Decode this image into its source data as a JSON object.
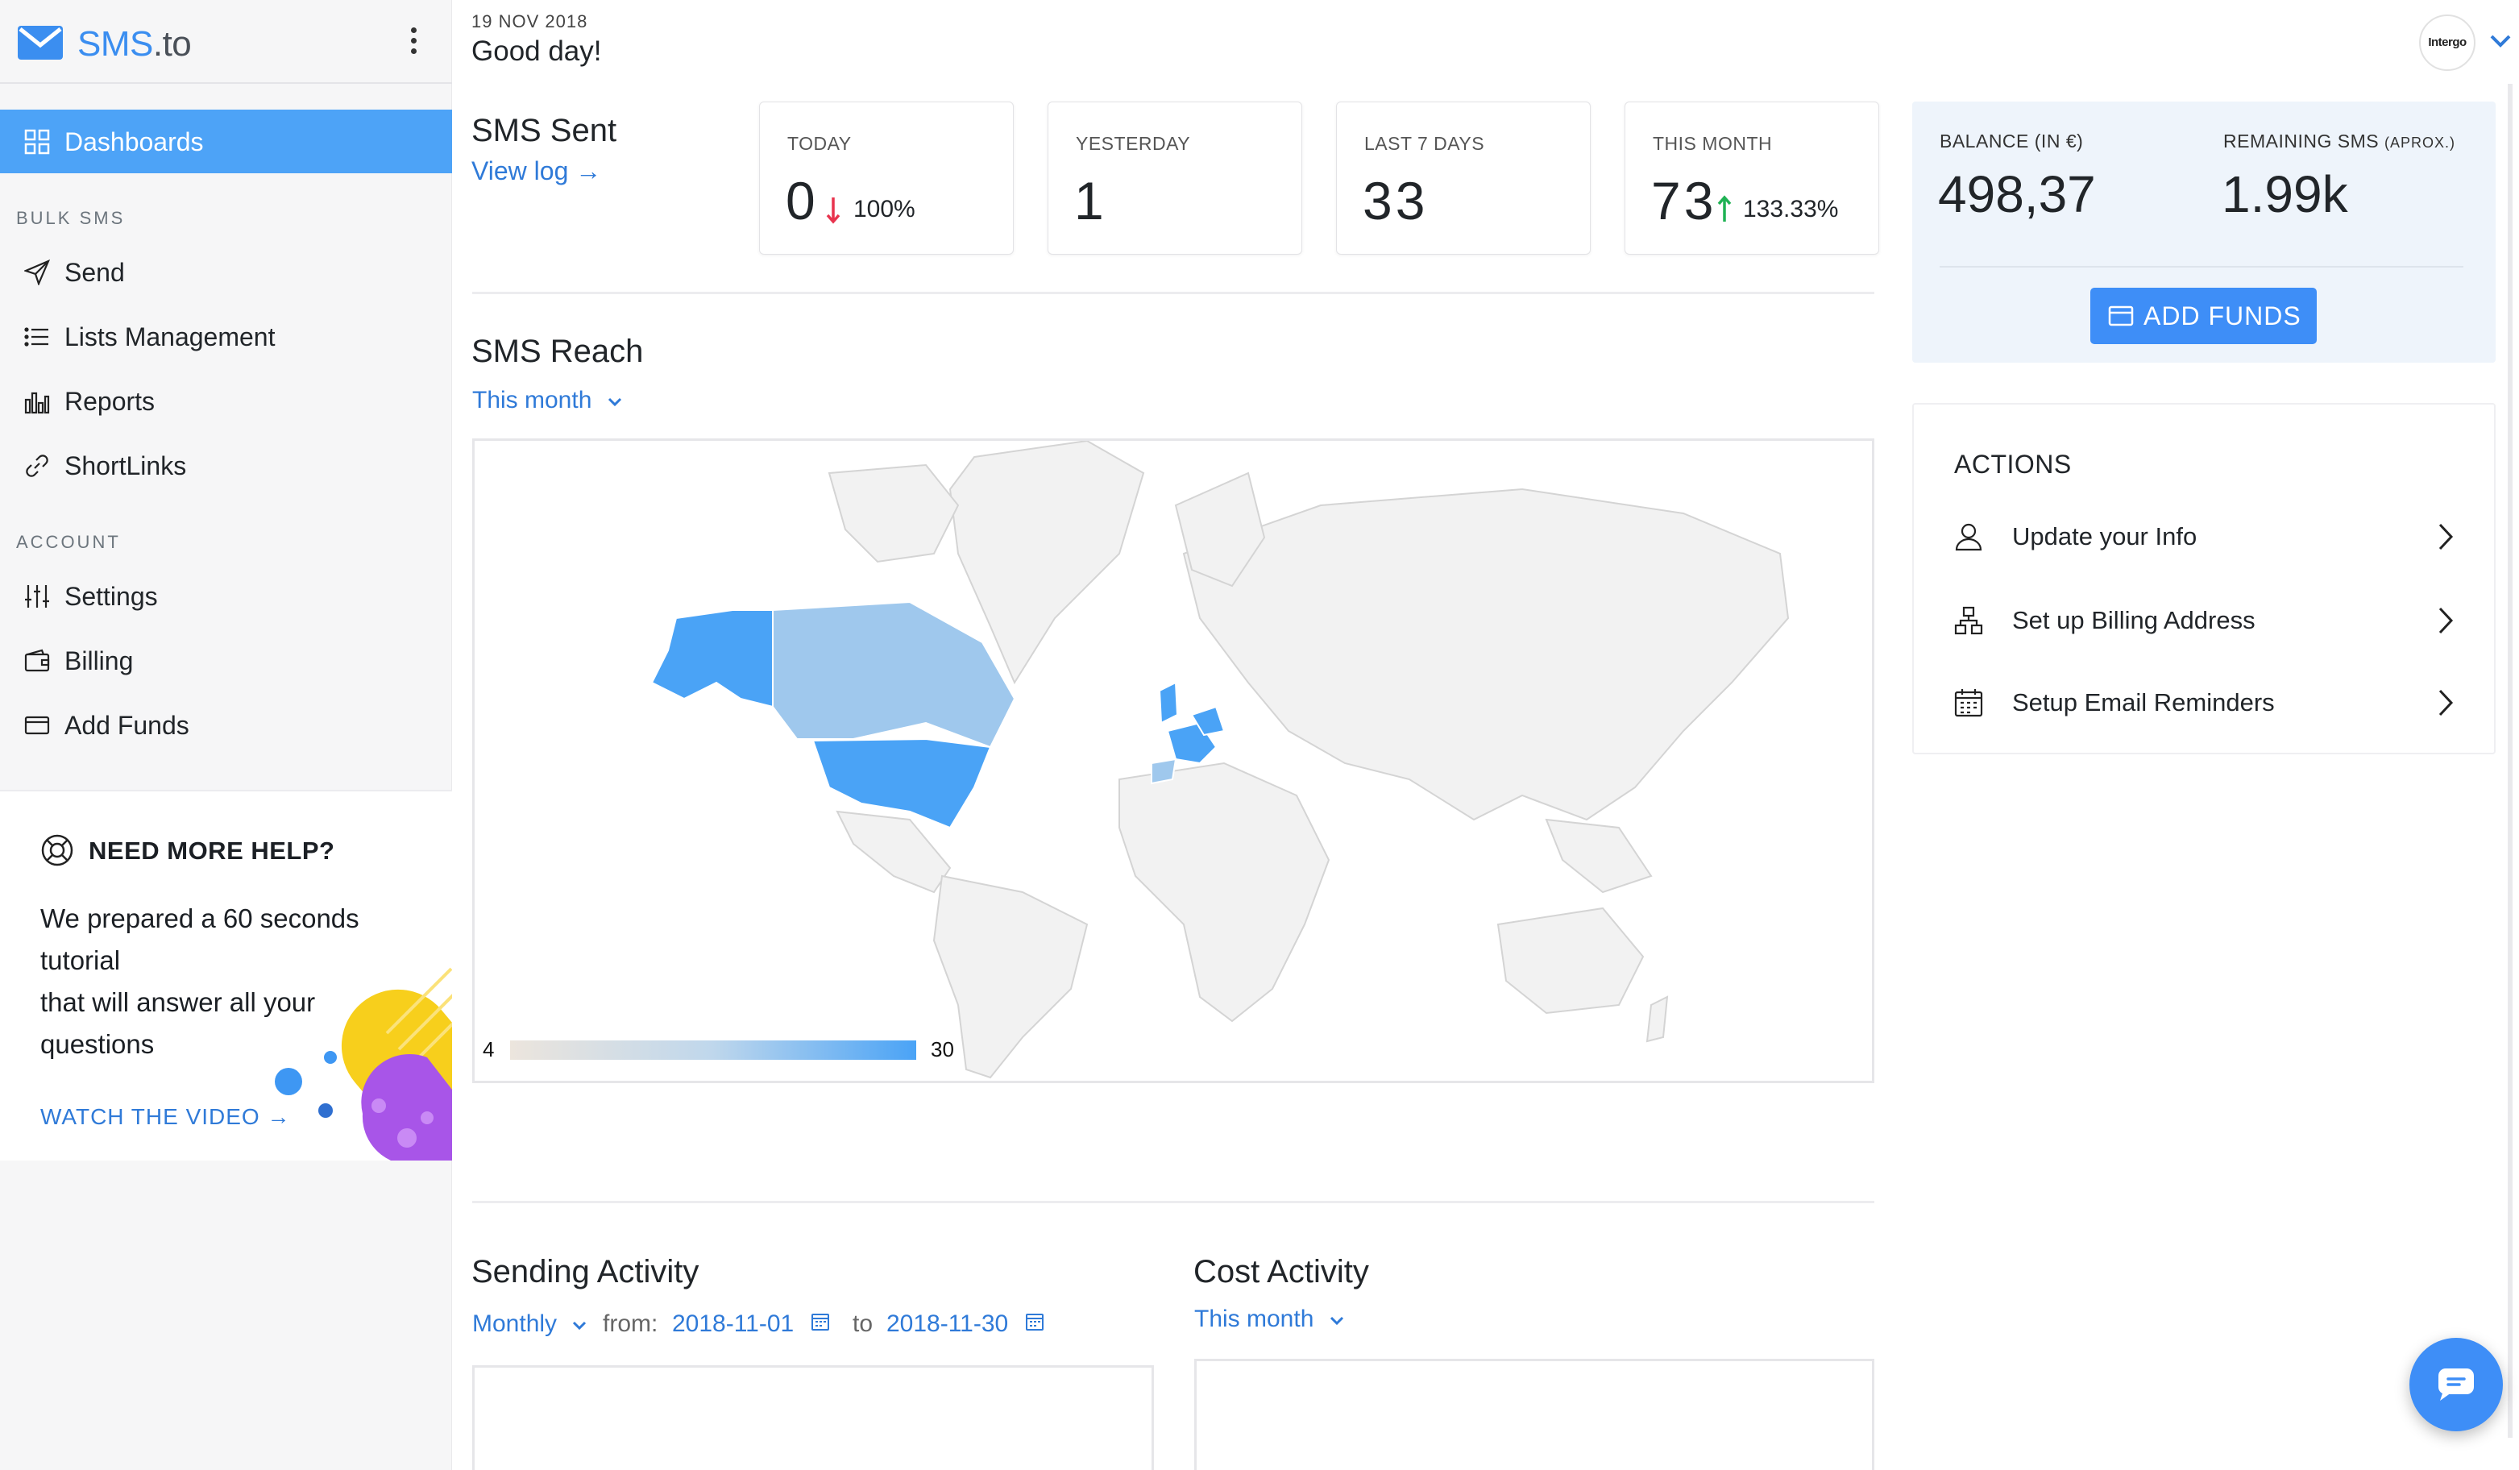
{
  "app": {
    "logo_main": "SMS",
    "logo_suffix": ".to"
  },
  "sidebar": {
    "active_item": {
      "label": "Dashboards",
      "icon": "grid-icon"
    },
    "sections": [
      {
        "label": "BULK SMS",
        "items": [
          {
            "label": "Send",
            "icon": "paper-plane-icon"
          },
          {
            "label": "Lists Management",
            "icon": "list-icon"
          },
          {
            "label": "Reports",
            "icon": "bar-chart-icon"
          },
          {
            "label": "ShortLinks",
            "icon": "link-icon"
          }
        ]
      },
      {
        "label": "ACCOUNT",
        "items": [
          {
            "label": "Settings",
            "icon": "sliders-icon"
          },
          {
            "label": "Billing",
            "icon": "wallet-icon"
          },
          {
            "label": "Add Funds",
            "icon": "credit-card-icon"
          }
        ]
      }
    ],
    "help": {
      "title": "NEED MORE HELP?",
      "body_line1": "We prepared a 60 seconds",
      "body_line2": "tutorial",
      "body_line3": "that will answer all your",
      "body_line4": "questions",
      "cta": "WATCH THE VIDEO →"
    }
  },
  "header": {
    "date": "19 NOV 2018",
    "greeting": "Good day!",
    "avatar_text": "Intergo"
  },
  "sms_sent": {
    "title": "SMS Sent",
    "view_log": "View log →",
    "cards": [
      {
        "label": "TODAY",
        "value": "0",
        "trend": "down",
        "change": "100%"
      },
      {
        "label": "YESTERDAY",
        "value": "1",
        "trend": "",
        "change": ""
      },
      {
        "label": "LAST 7 DAYS",
        "value": "33",
        "trend": "",
        "change": ""
      },
      {
        "label": "THIS MONTH",
        "value": "73",
        "trend": "up",
        "change": "133.33%"
      }
    ]
  },
  "balance": {
    "balance_label": "BALANCE (IN €)",
    "balance_value": "498,37",
    "remaining_label": "REMAINING SMS",
    "remaining_note": "(APROX.)",
    "remaining_value": "1.99k",
    "add_funds_label": "ADD FUNDS"
  },
  "actions": {
    "title": "ACTIONS",
    "items": [
      {
        "label": "Update your Info",
        "icon": "user-icon"
      },
      {
        "label": "Set up Billing Address",
        "icon": "sitemap-icon"
      },
      {
        "label": "Setup Email Reminders",
        "icon": "calendar-icon"
      }
    ]
  },
  "sms_reach": {
    "title": "SMS Reach",
    "period": "This month",
    "legend_min": "4",
    "legend_max": "30",
    "colors": {
      "low": "#ece5dd",
      "high": "#4aa3f6",
      "land": "#f2f2f2"
    }
  },
  "sending_activity": {
    "title": "Sending Activity",
    "interval": "Monthly",
    "from_label": "from:",
    "from_date": "2018-11-01",
    "to_label": "to",
    "to_date": "2018-11-30"
  },
  "cost_activity": {
    "title": "Cost Activity",
    "period": "This month"
  }
}
